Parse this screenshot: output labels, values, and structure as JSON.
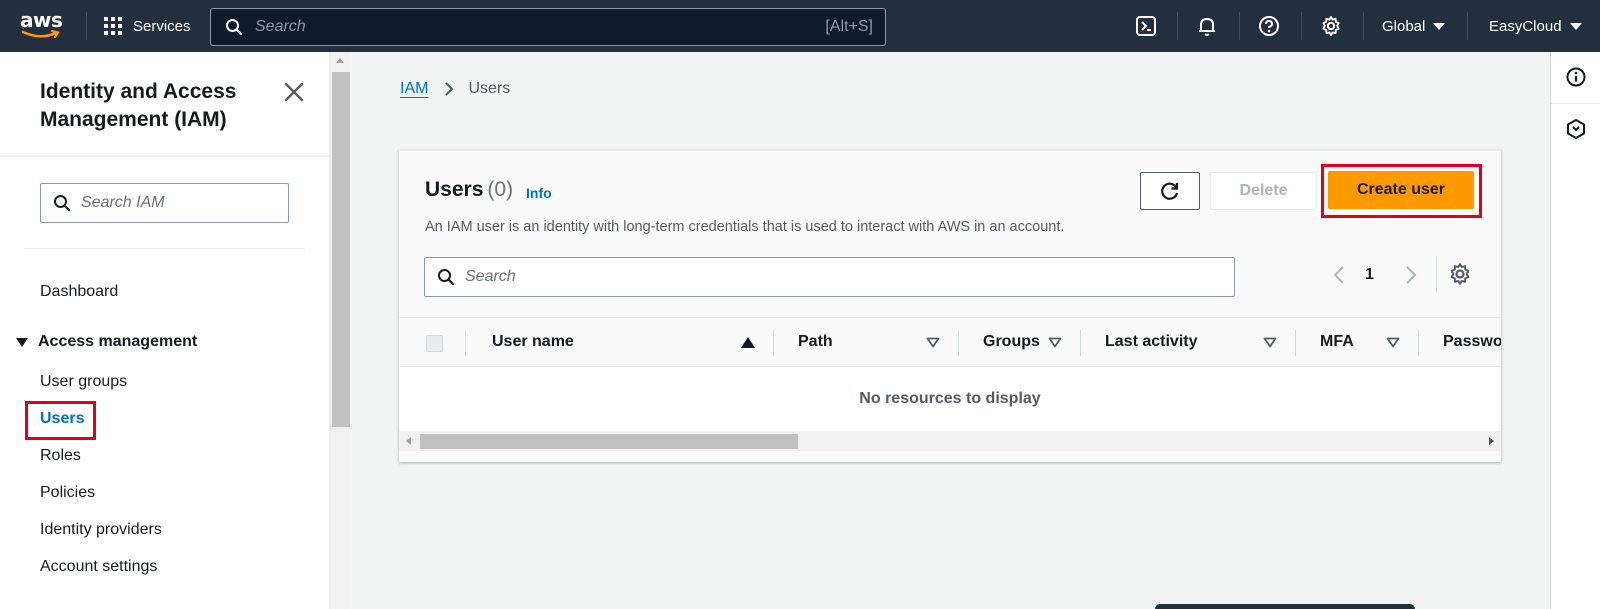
{
  "topnav": {
    "logo_text": "aws",
    "services_label": "Services",
    "search_placeholder": "Search",
    "search_shortcut": "[Alt+S]",
    "region_label": "Global",
    "account_label": "EasyCloud",
    "icons": [
      "cloudshell-icon",
      "notifications-bell-icon",
      "help-icon",
      "settings-gear-icon"
    ]
  },
  "sidebar": {
    "title": "Identity and Access Management (IAM)",
    "search_placeholder": "Search IAM",
    "dashboard_label": "Dashboard",
    "section_label": "Access management",
    "items": [
      {
        "label": "User groups",
        "active": false
      },
      {
        "label": "Users",
        "active": true
      },
      {
        "label": "Roles",
        "active": false
      },
      {
        "label": "Policies",
        "active": false
      },
      {
        "label": "Identity providers",
        "active": false
      },
      {
        "label": "Account settings",
        "active": false
      }
    ]
  },
  "breadcrumb": {
    "root": "IAM",
    "current": "Users"
  },
  "users_panel": {
    "title": "Users",
    "count": "(0)",
    "info_label": "Info",
    "description": "An IAM user is an identity with long-term credentials that is used to interact with AWS in an account.",
    "delete_label": "Delete",
    "create_label": "Create user",
    "search_placeholder": "Search",
    "page_number": "1",
    "columns": [
      "User name",
      "Path",
      "Groups",
      "Last activity",
      "MFA",
      "Password age"
    ],
    "empty_message": "No resources to display"
  },
  "colors": {
    "nav_bg": "#232f3e",
    "accent_orange": "#ff9900",
    "link_blue": "#0073bb",
    "highlight_red": "#e0001b"
  }
}
